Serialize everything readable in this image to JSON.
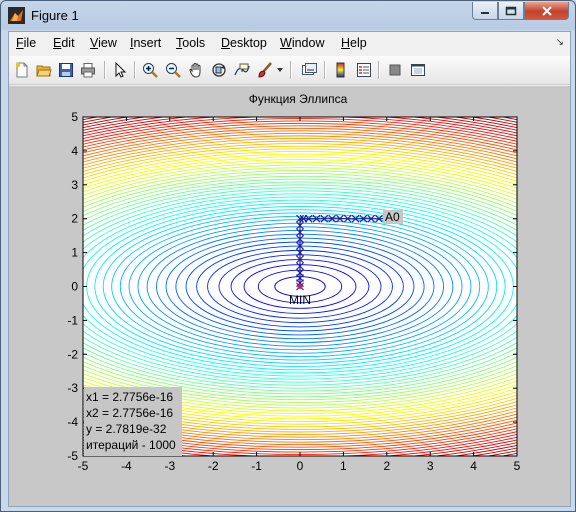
{
  "window": {
    "title": "Figure 1"
  },
  "menu": {
    "file": {
      "u": "F",
      "rest": "ile"
    },
    "edit": {
      "u": "E",
      "rest": "dit"
    },
    "view": {
      "u": "V",
      "rest": "iew"
    },
    "insert": {
      "u": "I",
      "rest": "nsert"
    },
    "tools": {
      "u": "T",
      "rest": "ools"
    },
    "desktop": {
      "u": "D",
      "rest": "esktop"
    },
    "window": {
      "u": "W",
      "rest": "indow"
    },
    "help": {
      "u": "H",
      "rest": "elp"
    }
  },
  "toolbar": {
    "icons": [
      "new-figure-icon",
      "open-file-icon",
      "save-icon",
      "print-icon",
      "edit-plot-icon",
      "zoom-in-icon",
      "zoom-out-icon",
      "pan-icon",
      "rotate-3d-icon",
      "data-cursor-icon",
      "brush-icon",
      "link-plot-icon",
      "colorbar-icon",
      "legend-icon",
      "hide-plot-tools-icon",
      "show-plot-tools-icon"
    ]
  },
  "plot": {
    "title": "Функция Эллипса",
    "x_ticks": [
      "-5",
      "-4",
      "-3",
      "-2",
      "-1",
      "0",
      "1",
      "2",
      "3",
      "4",
      "5"
    ],
    "y_ticks": [
      "5",
      "4",
      "3",
      "2",
      "1",
      "0",
      "-1",
      "-2",
      "-3",
      "-4",
      "-5"
    ],
    "start_label": "A0",
    "min_label": "MIN",
    "info": {
      "line1": "x1 = 2.7756e-16",
      "line2": "x2 = 2.7756e-16",
      "line3": "y = 2.7819e-32",
      "line4": "итераций - 1000"
    }
  },
  "chart_data": {
    "type": "contour",
    "title": "Функция Эллипса",
    "xlim": [
      -5,
      5
    ],
    "ylim": [
      -5,
      5
    ],
    "contour_function": "x1^2/4 + x2^2",
    "path": {
      "x": [
        2.0,
        1.82,
        1.64,
        1.46,
        1.28,
        1.1,
        0.92,
        0.74,
        0.56,
        0.38,
        0.2,
        0.08,
        0.0,
        0.0,
        0.0,
        0.0,
        0.0,
        0.0,
        0.0,
        0.0,
        0.0,
        0.0,
        0.0,
        0.0
      ],
      "y": [
        2.0,
        2.0,
        2.0,
        2.0,
        2.0,
        2.0,
        2.0,
        2.0,
        2.0,
        2.0,
        2.0,
        2.0,
        2.0,
        1.8,
        1.6,
        1.4,
        1.2,
        1.0,
        0.8,
        0.6,
        0.4,
        0.25,
        0.1,
        0.0
      ]
    },
    "start_point": [
      2,
      2
    ],
    "min_point": [
      0,
      0
    ]
  }
}
